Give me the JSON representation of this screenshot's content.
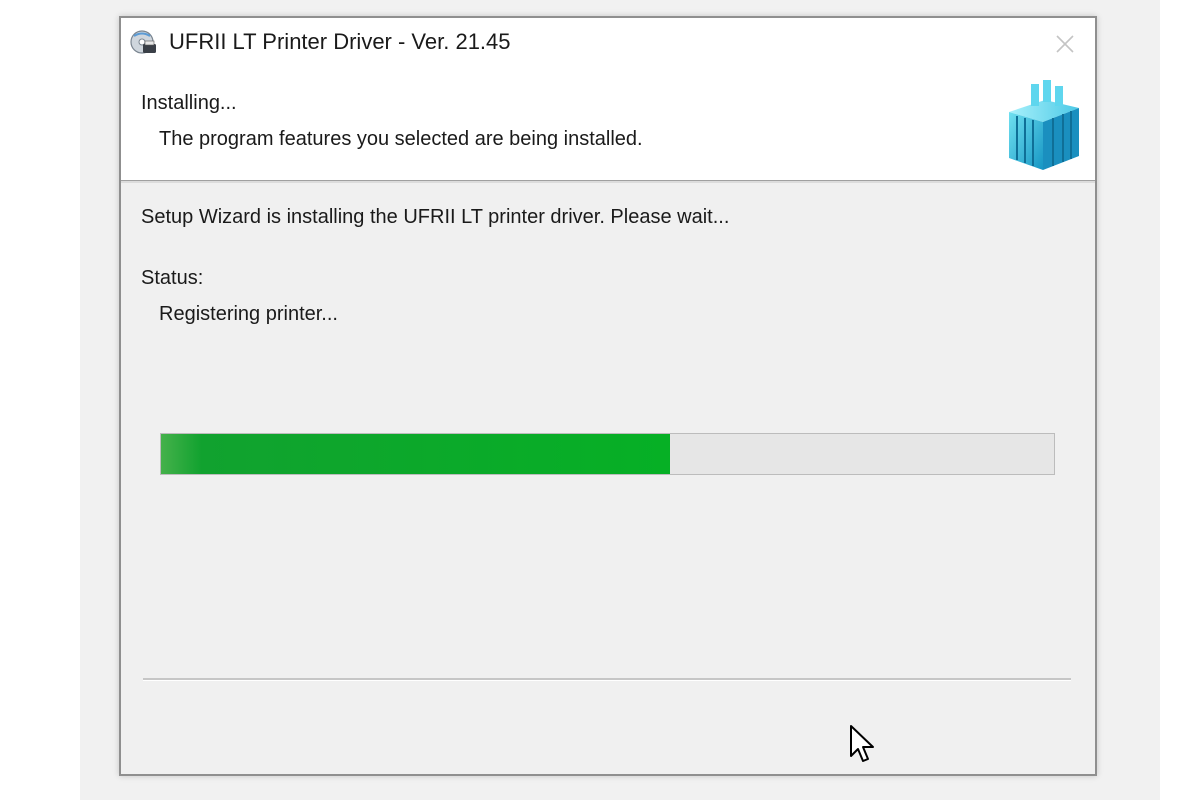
{
  "window": {
    "title": "UFRII LT Printer Driver - Ver. 21.45",
    "app_icon": "printer-cd-icon",
    "close_icon": "close-icon"
  },
  "header": {
    "title": "Installing...",
    "subtitle": "The program features you selected are being installed.",
    "graphic_icon": "blue-cube-logo-icon"
  },
  "body": {
    "message": "Setup Wizard is installing the UFRII LT printer driver. Please wait...",
    "status_label": "Status:",
    "status_value": "Registering printer..."
  },
  "progress": {
    "fraction": 0.57,
    "fill_color": "#06b025",
    "track_color": "#e6e6e6"
  },
  "pointer": {
    "icon": "mouse-cursor-icon"
  }
}
